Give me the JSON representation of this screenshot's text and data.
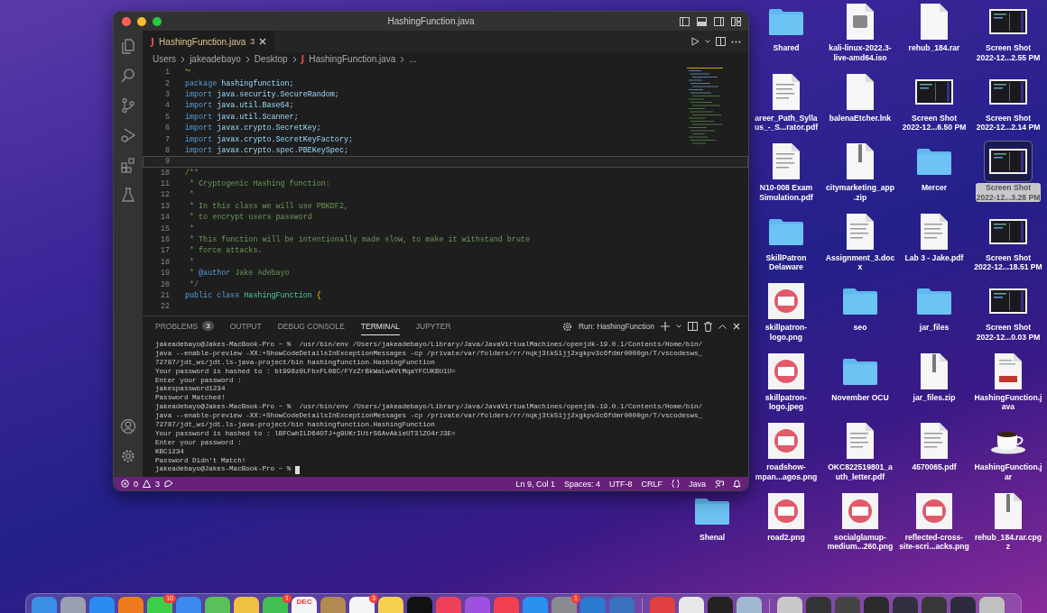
{
  "window": {
    "title": "HashingFunction.java"
  },
  "editor_tab": {
    "icon": "J",
    "label": "HashingFunction.java",
    "problems": "3",
    "selected": true
  },
  "breadcrumb": [
    {
      "label": "Users"
    },
    {
      "label": "jakeadebayo"
    },
    {
      "label": "Desktop"
    },
    {
      "icon": "J",
      "label": "HashingFunction.java"
    },
    {
      "label": "..."
    }
  ],
  "code_lines": [
    {
      "number": "1",
      "warning": true,
      "current": false
    },
    {
      "number": "2",
      "warning": false,
      "current": false,
      "tokens": [
        {
          "kind": "keyword",
          "text": "package "
        },
        {
          "kind": "name",
          "text": "hashingfunction;"
        }
      ]
    },
    {
      "number": "3",
      "warning": false,
      "current": false,
      "tokens": [
        {
          "kind": "keyword",
          "text": "import "
        },
        {
          "kind": "name",
          "text": "java.security.SecureRandom;"
        }
      ]
    },
    {
      "number": "4",
      "warning": false,
      "current": false,
      "tokens": [
        {
          "kind": "keyword",
          "text": "import "
        },
        {
          "kind": "name",
          "text": "java.util.Base64;"
        }
      ]
    },
    {
      "number": "5",
      "warning": false,
      "current": false,
      "tokens": [
        {
          "kind": "keyword",
          "text": "import "
        },
        {
          "kind": "name",
          "text": "java.util.Scanner;"
        }
      ]
    },
    {
      "number": "6",
      "warning": false,
      "current": false,
      "tokens": [
        {
          "kind": "keyword",
          "text": "import "
        },
        {
          "kind": "name",
          "text": "javax.crypto.SecretKey;"
        }
      ]
    },
    {
      "number": "7",
      "warning": false,
      "current": false,
      "tokens": [
        {
          "kind": "keyword",
          "text": "import "
        },
        {
          "kind": "name",
          "text": "javax.crypto.SecretKeyFactory;"
        }
      ]
    },
    {
      "number": "8",
      "warning": false,
      "current": false,
      "tokens": [
        {
          "kind": "keyword",
          "text": "import "
        },
        {
          "kind": "name",
          "text": "javax.crypto.spec.PBEKeySpec;"
        }
      ]
    },
    {
      "number": "9",
      "warning": false,
      "current": true
    },
    {
      "number": "10",
      "warning": false,
      "current": false,
      "tokens": [
        {
          "kind": "comment",
          "text": "/**"
        }
      ]
    },
    {
      "number": "11",
      "warning": false,
      "current": false,
      "tokens": [
        {
          "kind": "comment",
          "text": " * Cryptogenic Hashing function:"
        }
      ]
    },
    {
      "number": "12",
      "warning": false,
      "current": false,
      "tokens": [
        {
          "kind": "comment",
          "text": " *"
        }
      ]
    },
    {
      "number": "13",
      "warning": false,
      "current": false,
      "tokens": [
        {
          "kind": "comment",
          "text": " * In this class we will use PBKDF2,"
        }
      ]
    },
    {
      "number": "14",
      "warning": false,
      "current": false,
      "tokens": [
        {
          "kind": "comment",
          "text": " * to encrypt users password"
        }
      ]
    },
    {
      "number": "15",
      "warning": false,
      "current": false,
      "tokens": [
        {
          "kind": "comment",
          "text": " *"
        }
      ]
    },
    {
      "number": "16",
      "warning": false,
      "current": false,
      "tokens": [
        {
          "kind": "comment",
          "text": " * This function will be intentionally made slow, to make it withstand brute"
        }
      ]
    },
    {
      "number": "17",
      "warning": false,
      "current": false,
      "tokens": [
        {
          "kind": "comment",
          "text": " * force attacks."
        }
      ]
    },
    {
      "number": "18",
      "warning": false,
      "current": false,
      "tokens": [
        {
          "kind": "comment",
          "text": " *"
        }
      ]
    },
    {
      "number": "19",
      "warning": false,
      "current": false,
      "tokens": [
        {
          "kind": "comment",
          "text": " * "
        },
        {
          "kind": "tag",
          "text": "@author"
        },
        {
          "kind": "comment",
          "text": " Jake Adebayo"
        }
      ]
    },
    {
      "number": "20",
      "warning": false,
      "current": false,
      "tokens": [
        {
          "kind": "comment",
          "text": " */"
        }
      ]
    },
    {
      "number": "21",
      "warning": false,
      "current": false,
      "tokens": [
        {
          "kind": "keyword",
          "text": "public class "
        },
        {
          "kind": "type",
          "text": "HashingFunction"
        },
        {
          "kind": "brace",
          "text": " {"
        }
      ]
    },
    {
      "number": "22",
      "warning": false,
      "current": false
    }
  ],
  "panel": {
    "tabs": [
      {
        "label": "PROBLEMS",
        "badge": "3",
        "selected": false
      },
      {
        "label": "OUTPUT",
        "selected": false
      },
      {
        "label": "DEBUG CONSOLE",
        "selected": false
      },
      {
        "label": "TERMINAL",
        "selected": true
      },
      {
        "label": "JUPYTER",
        "selected": false
      }
    ],
    "run_label": "Run: HashingFunction",
    "terminal_lines": [
      "jakeadebayo@Jakes-MacBook-Pro ~ %  /usr/bin/env /Users/jakeadebayo/Library/Java/JavaVirtualMachines/openjdk-19.0.1/Contents/Home/bin/",
      "java --enable-preview -XX:+ShowCodeDetailsInExceptionMessages -cp /private/var/folders/rr/nqkj3tk51jj2xgkpv3c6fdmr0000gn/T/vscodesws_",
      "72787/jdt_ws/jdt.ls-java-project/bin hashingfunction.HashingFunction",
      "Your password is hashed to : bt998z0LFbxFL08C/FYzZrBkWaLw4VtMqaYFCUKBU1U=",
      "Enter your password :",
      "jakespassword1234",
      "Password Matched!",
      "jakeadebayo@Jakes-MacBook-Pro ~ %  /usr/bin/env /Users/jakeadebayo/Library/Java/JavaVirtualMachines/openjdk-19.0.1/Contents/Home/bin/",
      "java --enable-preview -XX:+ShowCodeDetailsInExceptionMessages -cp /private/var/folders/rr/nqkj3tk51jj2xgkpv3c6fdmr0000gn/T/vscodesws_",
      "72787/jdt_ws/jdt.ls-java-project/bin hashingfunction.HashingFunction",
      "Your password is hashed to : lBFCwhILD64OTJ+g9UKrIUtrS6AvAkieUT3lZO4rJ3E=",
      "Enter your password :",
      "KBC1234",
      "Password Didn't Match!",
      "jakeadebayo@Jakes-MacBook-Pro ~ %"
    ]
  },
  "status_bar": {
    "errors": "0",
    "warnings": "3",
    "position": "Ln 9, Col 1",
    "indent": "Spaces: 4",
    "encoding": "UTF-8",
    "line_ending": "CRLF",
    "language": "Java"
  },
  "desktop": {
    "columns": [
      {
        "items": [
          {
            "lines": [
              "Shenal"
            ],
            "kind": "folder",
            "selected": false
          }
        ]
      },
      {
        "items": [
          {
            "lines": [
              "Shared"
            ],
            "kind": "folder",
            "selected": false
          },
          {
            "lines": [
              "areer_Path_Sylla",
              "us_-_S...rator.pdf"
            ],
            "kind": "document",
            "selected": false
          },
          {
            "lines": [
              "N10-008 Exam",
              "Simulation.pdf"
            ],
            "kind": "document",
            "selected": false
          },
          {
            "lines": [
              "SkillPatron",
              "Delaware"
            ],
            "kind": "folder",
            "selected": false
          },
          {
            "lines": [
              "skillpatron-",
              "logo.png"
            ],
            "kind": "image",
            "selected": false
          },
          {
            "lines": [
              "skillpatron-",
              "logo.jpeg"
            ],
            "kind": "image",
            "selected": false
          },
          {
            "lines": [
              "roadshow-",
              "mpan...agos.png"
            ],
            "kind": "image",
            "selected": false
          },
          {
            "lines": [
              "road2.png"
            ],
            "kind": "image",
            "selected": false
          }
        ]
      },
      {
        "items": [
          {
            "lines": [
              "kali-linux-2022.3-",
              "live-amd64.iso"
            ],
            "kind": "disk",
            "selected": false
          },
          {
            "lines": [
              "balenaEtcher.lnk"
            ],
            "kind": "blank",
            "selected": false
          },
          {
            "lines": [
              "citymarketing_app",
              ".zip"
            ],
            "kind": "zip",
            "selected": false
          },
          {
            "lines": [
              "Assignment_3.doc",
              "x"
            ],
            "kind": "document",
            "selected": false
          },
          {
            "lines": [
              "seo"
            ],
            "kind": "folder",
            "selected": false
          },
          {
            "lines": [
              "November OCU"
            ],
            "kind": "folder",
            "selected": false
          },
          {
            "lines": [
              "OKC822519801_a",
              "uth_letter.pdf"
            ],
            "kind": "document",
            "selected": false
          },
          {
            "lines": [
              "socialglamup-",
              "medium...260.png"
            ],
            "kind": "image",
            "selected": false
          }
        ]
      },
      {
        "items": [
          {
            "lines": [
              "rehub_184.rar"
            ],
            "kind": "blank",
            "selected": false
          },
          {
            "lines": [
              "Screen Shot",
              "2022-12...6.50 PM"
            ],
            "kind": "screenshot",
            "selected": false
          },
          {
            "lines": [
              "Mercer"
            ],
            "kind": "folder",
            "selected": false
          },
          {
            "lines": [
              "Lab 3 - Jake.pdf"
            ],
            "kind": "document",
            "selected": false
          },
          {
            "lines": [
              "jar_files"
            ],
            "kind": "folder",
            "selected": false
          },
          {
            "lines": [
              "jar_files.zip"
            ],
            "kind": "zip",
            "selected": false
          },
          {
            "lines": [
              "4570065.pdf"
            ],
            "kind": "document",
            "selected": false
          },
          {
            "lines": [
              "reflected-cross-",
              "site-scri...acks.png"
            ],
            "kind": "image",
            "selected": false
          }
        ]
      },
      {
        "items": [
          {
            "lines": [
              "Screen Shot",
              "2022-12...2.55 PM"
            ],
            "kind": "screenshot",
            "selected": false
          },
          {
            "lines": [
              "Screen Shot",
              "2022-12...2.14 PM"
            ],
            "kind": "screenshot",
            "selected": false
          },
          {
            "lines": [
              "Screen Shot",
              "2022-12...3.28 PM"
            ],
            "kind": "screenshot",
            "selected": true
          },
          {
            "lines": [
              "Screen Shot",
              "2022-12...18.51 PM"
            ],
            "kind": "screenshot",
            "selected": false
          },
          {
            "lines": [
              "Screen Shot",
              "2022-12...0.03 PM"
            ],
            "kind": "screenshot",
            "selected": false
          },
          {
            "lines": [
              "HashingFunction.j",
              "ava"
            ],
            "kind": "java",
            "selected": false
          },
          {
            "lines": [
              "HashingFunction.j",
              "ar"
            ],
            "kind": "jar",
            "selected": false
          },
          {
            "lines": [
              "rehub_184.rar.cpg",
              "z"
            ],
            "kind": "zip",
            "selected": false
          }
        ]
      }
    ]
  },
  "dock": [
    {
      "kind": "app",
      "color": "#3a8ee6"
    },
    {
      "kind": "app",
      "color": "#9aa0b0"
    },
    {
      "kind": "app",
      "color": "#2a8cf0"
    },
    {
      "kind": "app",
      "color": "#f07a20"
    },
    {
      "kind": "app",
      "color": "#3ecf4a",
      "badge": "10"
    },
    {
      "kind": "app",
      "color": "#3a8af0"
    },
    {
      "kind": "app",
      "color": "#5ac05a"
    },
    {
      "kind": "app",
      "color": "#f0c040"
    },
    {
      "kind": "app",
      "color": "#40c050",
      "badge": "1"
    },
    {
      "kind": "app",
      "color": "#f4f4f4",
      "label": "DEC"
    },
    {
      "kind": "app",
      "color": "#b08a50"
    },
    {
      "kind": "app",
      "color": "#f4f4f4",
      "badge": "3"
    },
    {
      "kind": "app",
      "color": "#f5d050"
    },
    {
      "kind": "app",
      "color": "#111111"
    },
    {
      "kind": "app",
      "color": "#f0405a"
    },
    {
      "kind": "app",
      "color": "#a050e0"
    },
    {
      "kind": "app",
      "color": "#f04050"
    },
    {
      "kind": "app",
      "color": "#2a90f0"
    },
    {
      "kind": "app",
      "color": "#8a8a90",
      "badge": "1"
    },
    {
      "kind": "app",
      "color": "#2a7ad0"
    },
    {
      "kind": "app",
      "color": "#3a70c0"
    },
    {
      "kind": "separator"
    },
    {
      "kind": "app",
      "color": "#e04040"
    },
    {
      "kind": "app",
      "color": "#e8e8e8"
    },
    {
      "kind": "app",
      "color": "#222222"
    },
    {
      "kind": "app",
      "color": "#a0b8d0"
    },
    {
      "kind": "separator"
    },
    {
      "kind": "app",
      "color": "#c8c8c8"
    },
    {
      "kind": "app",
      "color": "#333333"
    },
    {
      "kind": "app",
      "color": "#444444"
    },
    {
      "kind": "app",
      "color": "#2a2a2a"
    },
    {
      "kind": "app",
      "color": "#303040"
    },
    {
      "kind": "app",
      "color": "#383838"
    },
    {
      "kind": "app",
      "color": "#2c2c3c"
    },
    {
      "kind": "app",
      "color": "#c0c0c0"
    }
  ]
}
